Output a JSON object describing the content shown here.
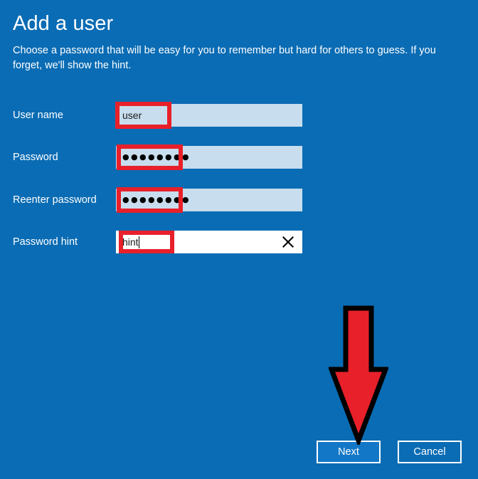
{
  "window": {
    "background_color": "#0a6cb4"
  },
  "header": {
    "title": "Add a user",
    "subtitle": "Choose a password that will be easy for you to remember but hard for others to guess. If you forget, we'll show the hint."
  },
  "form": {
    "fields": [
      {
        "label": "User name",
        "value": "user",
        "placeholder": "",
        "type": "text",
        "focused": false
      },
      {
        "label": "Password",
        "value": "●●●●●●●●",
        "placeholder": "",
        "type": "password",
        "focused": false
      },
      {
        "label": "Reenter password",
        "value": "●●●●●●●●",
        "placeholder": "",
        "type": "password",
        "focused": false
      },
      {
        "label": "Password hint",
        "value": "hint",
        "placeholder": "",
        "type": "text",
        "focused": true,
        "clear_icon": "close-icon"
      }
    ]
  },
  "buttons": {
    "next_label": "Next",
    "cancel_label": "Cancel"
  },
  "annotations": {
    "highlight_color": "#e8202a",
    "arrow": {
      "icon": "down-arrow-annotation",
      "fill_color": "#e8202a",
      "outline_color": "#000000",
      "points_at": "Next"
    }
  }
}
